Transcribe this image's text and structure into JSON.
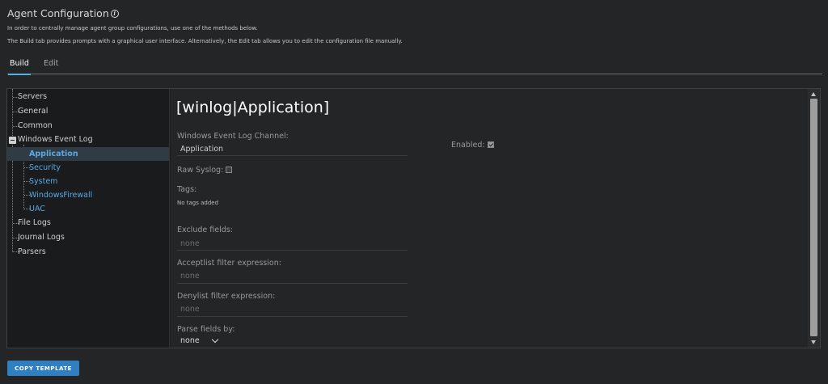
{
  "page": {
    "title": "Agent Configuration",
    "description_1": "In order to centrally manage agent group configurations, use one of the methods below.",
    "description_2": "The Build tab provides prompts with a graphical user interface. Alternatively, the Edit tab allows you to edit the configuration file manually."
  },
  "tabs": [
    {
      "label": "Build",
      "active": true
    },
    {
      "label": "Edit",
      "active": false
    }
  ],
  "tree": {
    "items": [
      {
        "label": "Servers"
      },
      {
        "label": "General"
      },
      {
        "label": "Common"
      },
      {
        "label": "Windows Event Log"
      },
      {
        "label": "Application"
      },
      {
        "label": "Security"
      },
      {
        "label": "System"
      },
      {
        "label": "WindowsFirewall"
      },
      {
        "label": "UAC"
      },
      {
        "label": "File Logs"
      },
      {
        "label": "Journal Logs"
      },
      {
        "label": "Parsers"
      }
    ]
  },
  "detail": {
    "heading": "[winlog|Application]",
    "channel_label": "Windows Event Log Channel:",
    "channel_value": "Application",
    "enabled_label": "Enabled:",
    "enabled_checked": true,
    "raw_syslog_label": "Raw Syslog:",
    "raw_syslog_checked": false,
    "tags_label": "Tags:",
    "tags_value": "No tags added",
    "exclude_label": "Exclude fields:",
    "exclude_value": "none",
    "acceptlist_label": "Acceptlist filter expression:",
    "acceptlist_value": "none",
    "denylist_label": "Denylist filter expression:",
    "denylist_value": "none",
    "parse_label": "Parse fields by:",
    "parse_value": "none"
  },
  "footer": {
    "copy_button": "COPY TEMPLATE"
  },
  "colors": {
    "accent": "#4fb5e6",
    "link": "#5aa9e6",
    "button": "#2f7fc1",
    "background": "#232526"
  }
}
